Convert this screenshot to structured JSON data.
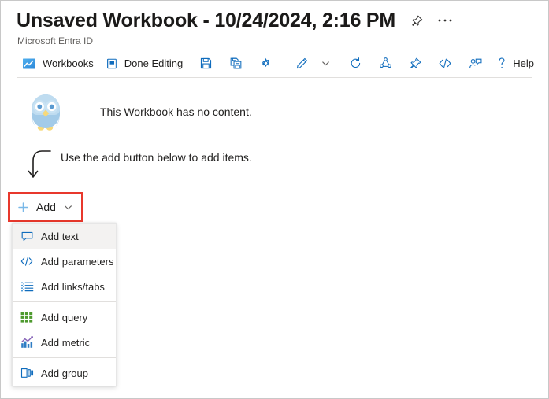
{
  "window": {
    "title": "Unsaved Workbook - 10/24/2024, 2:16 PM",
    "subtitle": "Microsoft Entra ID",
    "pin_icon": "pin-icon",
    "more_icon": "ellipsis-icon"
  },
  "toolbar": {
    "items": [
      {
        "label": "Workbooks",
        "icon": "workbooks-icon"
      },
      {
        "label": "Done Editing",
        "icon": "done-editing-icon"
      },
      {
        "label": "",
        "icon": "save-icon"
      },
      {
        "label": "",
        "icon": "save-as-icon"
      },
      {
        "label": "",
        "icon": "settings-gear-icon"
      },
      {
        "label": "",
        "icon": "edit-pencil-icon"
      },
      {
        "label": "",
        "icon": "chevron-down-icon"
      },
      {
        "label": "",
        "icon": "refresh-icon"
      },
      {
        "label": "",
        "icon": "share-icon"
      },
      {
        "label": "",
        "icon": "pin-icon"
      },
      {
        "label": "",
        "icon": "code-icon"
      },
      {
        "label": "",
        "icon": "feedback-icon"
      }
    ],
    "help": {
      "label": "Help",
      "icon": "help-question-icon"
    }
  },
  "content": {
    "empty_message": "This Workbook has no content.",
    "hint_message": "Use the add button below to add items.",
    "owl_icon": "owl-illustration",
    "hint_arrow_icon": "curved-arrow-down-icon"
  },
  "add_button": {
    "label": "Add",
    "plus_icon": "plus-icon",
    "chevron_icon": "chevron-down-icon",
    "highlight_color": "#e8382c"
  },
  "add_menu": {
    "groups": [
      {
        "items": [
          {
            "label": "Add text",
            "icon": "speech-bubble-icon",
            "selected": true
          },
          {
            "label": "Add parameters",
            "icon": "code-brackets-icon",
            "selected": false
          },
          {
            "label": "Add links/tabs",
            "icon": "list-icon",
            "selected": false
          }
        ]
      },
      {
        "items": [
          {
            "label": "Add query",
            "icon": "grid-green-icon",
            "selected": false
          },
          {
            "label": "Add metric",
            "icon": "metric-chart-icon",
            "selected": false
          }
        ]
      },
      {
        "items": [
          {
            "label": "Add group",
            "icon": "group-icon",
            "selected": false
          }
        ]
      }
    ]
  },
  "colors": {
    "accent_blue": "#0f6cbd",
    "highlight_red": "#e8382c",
    "menu_hover": "#f3f2f1",
    "owl_body": "#a3cbe8",
    "owl_head": "#bfdcf0",
    "owl_beak": "#f7d97a"
  }
}
